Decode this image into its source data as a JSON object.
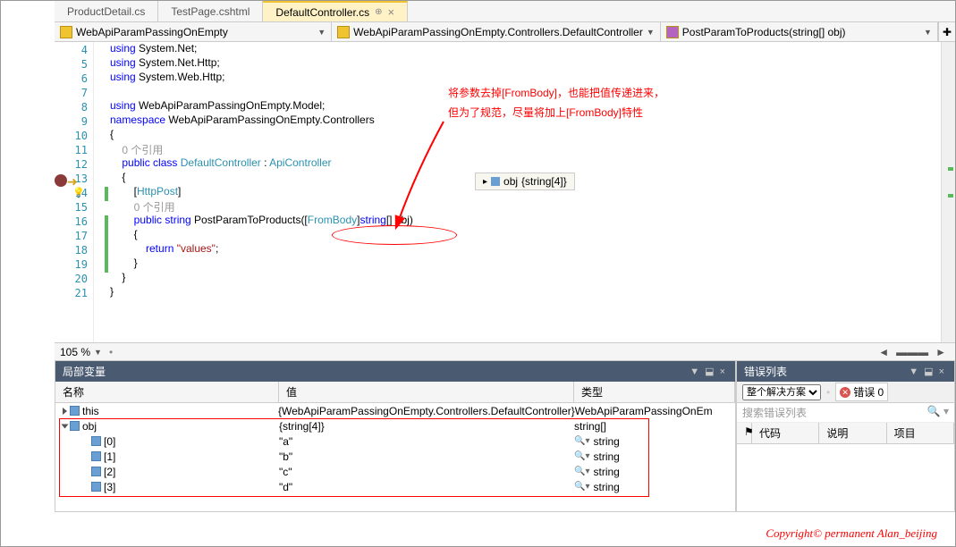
{
  "tabs": [
    {
      "label": "ProductDetail.cs"
    },
    {
      "label": "TestPage.cshtml"
    },
    {
      "label": "DefaultController.cs",
      "active": true
    }
  ],
  "nav": {
    "project": "WebApiParamPassingOnEmpty",
    "class": "WebApiParamPassingOnEmpty.Controllers.DefaultController",
    "member": "PostParamToProducts(string[] obj)"
  },
  "code": {
    "lines": [
      {
        "n": 4,
        "html": "<span class='kw'>using</span> System.Net;"
      },
      {
        "n": 5,
        "html": "<span class='kw'>using</span> System.Net.Http;"
      },
      {
        "n": 6,
        "html": "<span class='kw'>using</span> System.Web.Http;"
      },
      {
        "n": 7,
        "html": ""
      },
      {
        "n": 8,
        "html": "<span class='kw'>using</span> WebApiParamPassingOnEmpty.Model;"
      },
      {
        "n": 9,
        "html": "<span class='kw'>namespace</span> WebApiParamPassingOnEmpty.Controllers"
      },
      {
        "n": 10,
        "html": "{"
      },
      {
        "n": 11,
        "html": "    <span class='gray'>0 个引用</span>"
      },
      {
        "n": 12,
        "html": "    <span class='kw'>public</span> <span class='kw'>class</span> <span class='tp'>DefaultController</span> : <span class='tp'>ApiController</span>"
      },
      {
        "n": 13,
        "html": "    {"
      },
      {
        "n": 14,
        "html": "        [<span class='tp'>HttpPost</span>]"
      },
      {
        "n": 15,
        "html": "        <span class='gray'>0 个引用</span>"
      },
      {
        "n": 16,
        "html": "        <span class='kw'>public</span> <span class='kw'>string</span> PostParamToProducts([<span class='tp'>FromBody</span>]<span class='kw'>string</span>[] obj)"
      },
      {
        "n": 17,
        "html": "        {"
      },
      {
        "n": 18,
        "html": "            <span class='kw'>return</span> <span class='str'>\"values\"</span>;"
      },
      {
        "n": 19,
        "html": "        }"
      },
      {
        "n": 20,
        "html": "    }"
      },
      {
        "n": 21,
        "html": "}"
      }
    ]
  },
  "tooltip": {
    "var": "obj",
    "val": "{string[4]}"
  },
  "annotation": {
    "line1": "将参数去掉[FromBody]，也能把值传递进来，",
    "line2": "但为了规范，尽量将加上[FromBody]特性"
  },
  "zoom": "105 %",
  "locals": {
    "title": "局部变量",
    "headers": {
      "name": "名称",
      "value": "值",
      "type": "类型"
    },
    "rows": [
      {
        "exp": "tri",
        "icon": "cube",
        "name": "this",
        "value": "{WebApiParamPassingOnEmpty.Controllers.DefaultController}",
        "type": "WebApiParamPassingOnEm",
        "indent": 0
      },
      {
        "exp": "tri open",
        "icon": "cube",
        "name": "obj",
        "value": "{string[4]}",
        "type": "string[]",
        "indent": 0
      },
      {
        "icon": "cube",
        "name": "[0]",
        "value": "\"a\"",
        "type": "string",
        "mag": true,
        "indent": 1
      },
      {
        "icon": "cube",
        "name": "[1]",
        "value": "\"b\"",
        "type": "string",
        "mag": true,
        "indent": 1
      },
      {
        "icon": "cube",
        "name": "[2]",
        "value": "\"c\"",
        "type": "string",
        "mag": true,
        "indent": 1
      },
      {
        "icon": "cube",
        "name": "[3]",
        "value": "\"d\"",
        "type": "string",
        "mag": true,
        "indent": 1
      }
    ]
  },
  "errors": {
    "title": "错误列表",
    "filter": "整个解决方案",
    "errbtn": "错误 0",
    "search": "搜索错误列表",
    "cols": {
      "code": "代码",
      "desc": "说明",
      "proj": "项目"
    }
  },
  "copyright": "Copyright©  permanent   Alan_beijing"
}
